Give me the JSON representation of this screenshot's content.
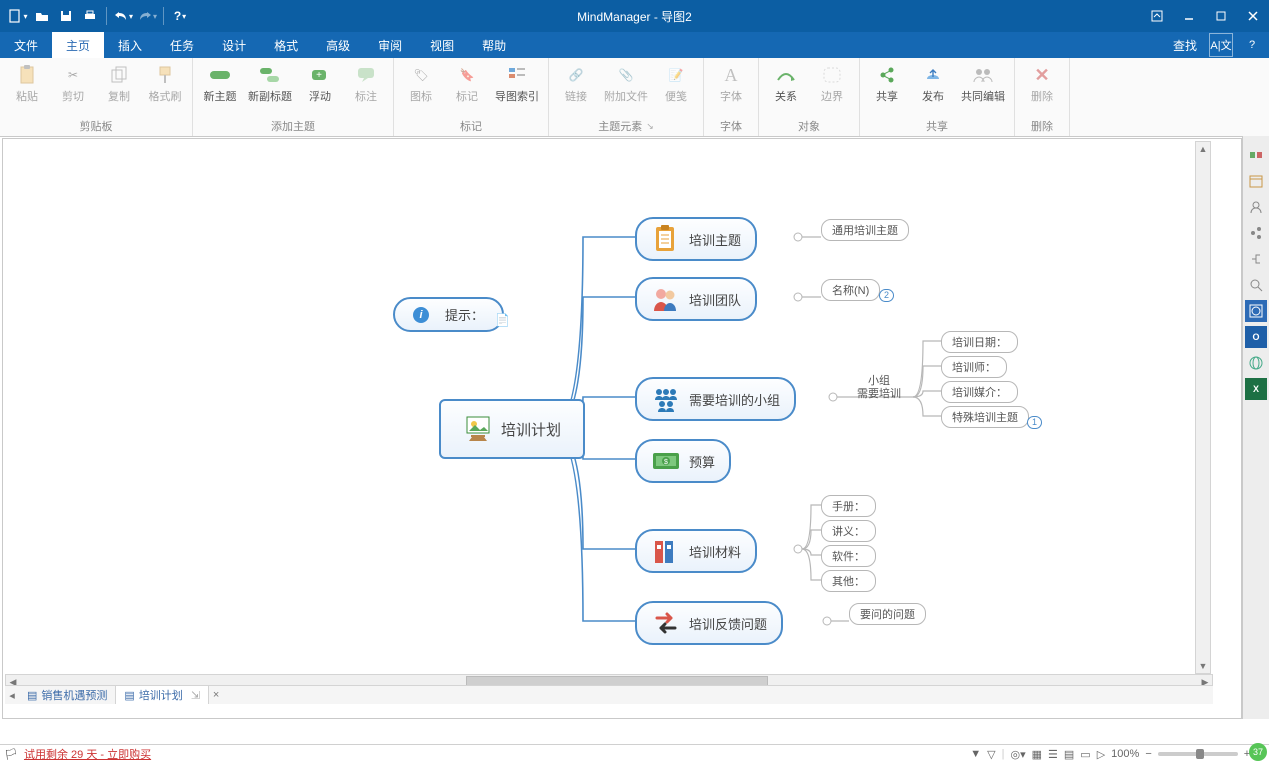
{
  "app_title": "MindManager - 导图2",
  "qat": {
    "new": "新建",
    "open": "打开",
    "save": "保存",
    "print": "打印",
    "undo": "撤销",
    "redo": "重做",
    "help": "帮助"
  },
  "tabs": [
    "文件",
    "主页",
    "插入",
    "任务",
    "设计",
    "格式",
    "高级",
    "审阅",
    "视图",
    "帮助"
  ],
  "tab_active_index": 1,
  "tab_right": {
    "find": "查找"
  },
  "ribbon": {
    "clipboard": {
      "name": "剪贴板",
      "paste": "粘贴",
      "cut": "剪切",
      "copy": "复制",
      "format_painter": "格式刷"
    },
    "add_topic": {
      "name": "添加主题",
      "new_topic": "新主题",
      "new_subtopic": "新副标题",
      "floating": "浮动",
      "callout": "标注"
    },
    "markers": {
      "name": "标记",
      "icon": "图标",
      "tag": "标记",
      "map_index": "导图索引"
    },
    "topic_elements": {
      "name": "主题元素",
      "link": "链接",
      "attachment": "附加文件",
      "note": "便笺"
    },
    "font": {
      "name": "字体",
      "font": "字体"
    },
    "object": {
      "name": "对象",
      "relationship": "关系",
      "boundary": "边界"
    },
    "share": {
      "name": "共享",
      "share": "共享",
      "publish": "发布",
      "coedit": "共同编辑"
    },
    "delete": {
      "name": "删除",
      "delete": "删除"
    }
  },
  "mindmap": {
    "central": "培训计划",
    "hint": "提示：",
    "sub1": "培训主题",
    "sub1_child": "通用培训主题",
    "sub2": "培训团队",
    "sub2_child": "名称(N)",
    "sub2_badge": "2",
    "sub3": "需要培训的小组",
    "sub3_label_a": "小组",
    "sub3_label_b": "需要培训",
    "sub3_c1": "培训日期：",
    "sub3_c2": "培训师：",
    "sub3_c3": "培训媒介：",
    "sub3_c4": "特殊培训主题",
    "sub3_badge": "1",
    "sub4": "预算",
    "sub5": "培训材料",
    "sub5_c1": "手册：",
    "sub5_c2": "讲义：",
    "sub5_c3": "软件：",
    "sub5_c4": "其他：",
    "sub6": "培训反馈问题",
    "sub6_child": "要问的问题"
  },
  "doc_tabs": {
    "tab1": "销售机遇预测",
    "tab2": "培训计划"
  },
  "status": {
    "trial": "试用剩余 29 天 - 立即购买",
    "zoom": "100%",
    "green": "37"
  }
}
